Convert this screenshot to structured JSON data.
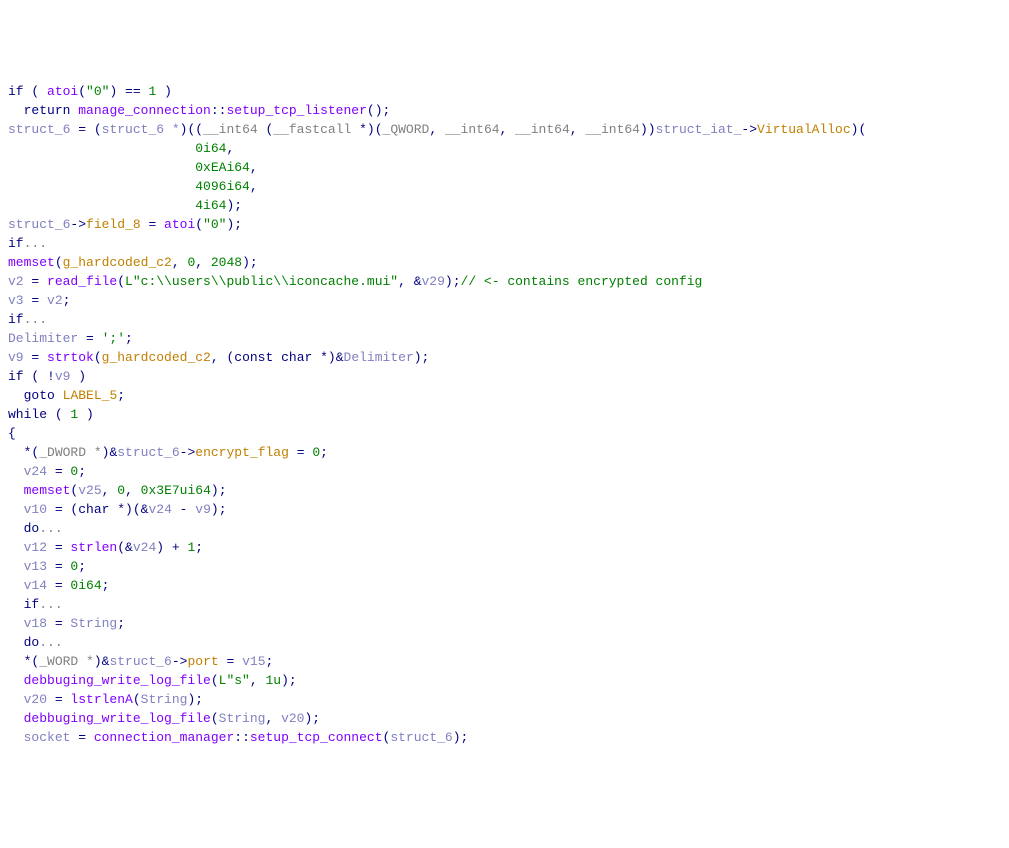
{
  "code": {
    "lines": [
      [
        {
          "t": "if",
          "c": "c-kw"
        },
        {
          "t": " ( ",
          "c": "c-punc"
        },
        {
          "t": "atoi",
          "c": "c-fn"
        },
        {
          "t": "(",
          "c": "c-punc"
        },
        {
          "t": "\"0\"",
          "c": "c-str"
        },
        {
          "t": ") == ",
          "c": "c-punc"
        },
        {
          "t": "1",
          "c": "c-num"
        },
        {
          "t": " )",
          "c": "c-punc"
        }
      ],
      [
        {
          "t": "  ",
          "c": "c-punc"
        },
        {
          "t": "return",
          "c": "c-kw"
        },
        {
          "t": " ",
          "c": "c-punc"
        },
        {
          "t": "manage_connection",
          "c": "c-fn"
        },
        {
          "t": "::",
          "c": "c-punc"
        },
        {
          "t": "setup_tcp_listener",
          "c": "c-fn"
        },
        {
          "t": "();",
          "c": "c-punc"
        }
      ],
      [
        {
          "t": "struct_6",
          "c": "c-var"
        },
        {
          "t": " = (",
          "c": "c-punc"
        },
        {
          "t": "struct_6 *",
          "c": "c-var"
        },
        {
          "t": ")((",
          "c": "c-punc"
        },
        {
          "t": "__int64",
          "c": "c-type"
        },
        {
          "t": " (",
          "c": "c-punc"
        },
        {
          "t": "__fastcall",
          "c": "c-type"
        },
        {
          "t": " *)(",
          "c": "c-punc"
        },
        {
          "t": "_QWORD",
          "c": "c-type"
        },
        {
          "t": ", ",
          "c": "c-punc"
        },
        {
          "t": "__int64",
          "c": "c-type"
        },
        {
          "t": ", ",
          "c": "c-punc"
        },
        {
          "t": "__int64",
          "c": "c-type"
        },
        {
          "t": ", ",
          "c": "c-punc"
        },
        {
          "t": "__int64",
          "c": "c-type"
        },
        {
          "t": "))",
          "c": "c-punc"
        },
        {
          "t": "struct_iat_",
          "c": "c-var"
        },
        {
          "t": "->",
          "c": "c-punc"
        },
        {
          "t": "VirtualAlloc",
          "c": "c-mem"
        },
        {
          "t": ")(",
          "c": "c-punc"
        }
      ],
      [
        {
          "t": "                        ",
          "c": "c-punc"
        },
        {
          "t": "0i64",
          "c": "c-num"
        },
        {
          "t": ",",
          "c": "c-punc"
        }
      ],
      [
        {
          "t": "                        ",
          "c": "c-punc"
        },
        {
          "t": "0xEAi64",
          "c": "c-num"
        },
        {
          "t": ",",
          "c": "c-punc"
        }
      ],
      [
        {
          "t": "                        ",
          "c": "c-punc"
        },
        {
          "t": "4096i64",
          "c": "c-num"
        },
        {
          "t": ",",
          "c": "c-punc"
        }
      ],
      [
        {
          "t": "                        ",
          "c": "c-punc"
        },
        {
          "t": "4i64",
          "c": "c-num"
        },
        {
          "t": ");",
          "c": "c-punc"
        }
      ],
      [
        {
          "t": "struct_6",
          "c": "c-var"
        },
        {
          "t": "->",
          "c": "c-punc"
        },
        {
          "t": "field_8",
          "c": "c-mem"
        },
        {
          "t": " = ",
          "c": "c-punc"
        },
        {
          "t": "atoi",
          "c": "c-fn"
        },
        {
          "t": "(",
          "c": "c-punc"
        },
        {
          "t": "\"0\"",
          "c": "c-str"
        },
        {
          "t": ");",
          "c": "c-punc"
        }
      ],
      [
        {
          "t": "if",
          "c": "c-kw"
        },
        {
          "t": "...",
          "c": "c-type"
        }
      ],
      [
        {
          "t": "memset",
          "c": "c-fn"
        },
        {
          "t": "(",
          "c": "c-punc"
        },
        {
          "t": "g_hardcoded_c2",
          "c": "c-glob"
        },
        {
          "t": ", ",
          "c": "c-punc"
        },
        {
          "t": "0",
          "c": "c-num"
        },
        {
          "t": ", ",
          "c": "c-punc"
        },
        {
          "t": "2048",
          "c": "c-num"
        },
        {
          "t": ");",
          "c": "c-punc"
        }
      ],
      [
        {
          "t": "v2",
          "c": "c-var"
        },
        {
          "t": " = ",
          "c": "c-punc"
        },
        {
          "t": "read_file",
          "c": "c-fn"
        },
        {
          "t": "(",
          "c": "c-punc"
        },
        {
          "t": "L\"c:\\\\users\\\\public\\\\iconcache.mui\"",
          "c": "c-str"
        },
        {
          "t": ", &",
          "c": "c-punc"
        },
        {
          "t": "v29",
          "c": "c-var"
        },
        {
          "t": ");",
          "c": "c-punc"
        },
        {
          "t": "// <- contains encrypted config",
          "c": "c-cmt"
        }
      ],
      [
        {
          "t": "v3",
          "c": "c-var"
        },
        {
          "t": " = ",
          "c": "c-punc"
        },
        {
          "t": "v2",
          "c": "c-var"
        },
        {
          "t": ";",
          "c": "c-punc"
        }
      ],
      [
        {
          "t": "if",
          "c": "c-kw"
        },
        {
          "t": "...",
          "c": "c-type"
        }
      ],
      [
        {
          "t": "Delimiter",
          "c": "c-var"
        },
        {
          "t": " = ",
          "c": "c-punc"
        },
        {
          "t": "';'",
          "c": "c-str"
        },
        {
          "t": ";",
          "c": "c-punc"
        }
      ],
      [
        {
          "t": "v9",
          "c": "c-var"
        },
        {
          "t": " = ",
          "c": "c-punc"
        },
        {
          "t": "strtok",
          "c": "c-fn"
        },
        {
          "t": "(",
          "c": "c-punc"
        },
        {
          "t": "g_hardcoded_c2",
          "c": "c-glob"
        },
        {
          "t": ", (",
          "c": "c-punc"
        },
        {
          "t": "const",
          "c": "c-kw"
        },
        {
          "t": " ",
          "c": "c-punc"
        },
        {
          "t": "char",
          "c": "c-kw"
        },
        {
          "t": " *)&",
          "c": "c-punc"
        },
        {
          "t": "Delimiter",
          "c": "c-var"
        },
        {
          "t": ");",
          "c": "c-punc"
        }
      ],
      [
        {
          "t": "if",
          "c": "c-kw"
        },
        {
          "t": " ( !",
          "c": "c-punc"
        },
        {
          "t": "v9",
          "c": "c-var"
        },
        {
          "t": " )",
          "c": "c-punc"
        }
      ],
      [
        {
          "t": "  ",
          "c": "c-punc"
        },
        {
          "t": "goto",
          "c": "c-kw"
        },
        {
          "t": " ",
          "c": "c-punc"
        },
        {
          "t": "LABEL_5",
          "c": "c-glob"
        },
        {
          "t": ";",
          "c": "c-punc"
        }
      ],
      [
        {
          "t": "while",
          "c": "c-kw"
        },
        {
          "t": " ( ",
          "c": "c-punc"
        },
        {
          "t": "1",
          "c": "c-num"
        },
        {
          "t": " )",
          "c": "c-punc"
        }
      ],
      [
        {
          "t": "{",
          "c": "c-punc"
        }
      ],
      [
        {
          "t": "  *(",
          "c": "c-punc"
        },
        {
          "t": "_DWORD *",
          "c": "c-type"
        },
        {
          "t": ")&",
          "c": "c-punc"
        },
        {
          "t": "struct_6",
          "c": "c-var"
        },
        {
          "t": "->",
          "c": "c-punc"
        },
        {
          "t": "encrypt_flag",
          "c": "c-mem"
        },
        {
          "t": " = ",
          "c": "c-punc"
        },
        {
          "t": "0",
          "c": "c-num"
        },
        {
          "t": ";",
          "c": "c-punc"
        }
      ],
      [
        {
          "t": "  ",
          "c": "c-punc"
        },
        {
          "t": "v24",
          "c": "c-var"
        },
        {
          "t": " = ",
          "c": "c-punc"
        },
        {
          "t": "0",
          "c": "c-num"
        },
        {
          "t": ";",
          "c": "c-punc"
        }
      ],
      [
        {
          "t": "  ",
          "c": "c-punc"
        },
        {
          "t": "memset",
          "c": "c-fn"
        },
        {
          "t": "(",
          "c": "c-punc"
        },
        {
          "t": "v25",
          "c": "c-var"
        },
        {
          "t": ", ",
          "c": "c-punc"
        },
        {
          "t": "0",
          "c": "c-num"
        },
        {
          "t": ", ",
          "c": "c-punc"
        },
        {
          "t": "0x3E7ui64",
          "c": "c-num"
        },
        {
          "t": ");",
          "c": "c-punc"
        }
      ],
      [
        {
          "t": "  ",
          "c": "c-punc"
        },
        {
          "t": "v10",
          "c": "c-var"
        },
        {
          "t": " = (",
          "c": "c-punc"
        },
        {
          "t": "char",
          "c": "c-kw"
        },
        {
          "t": " *)(&",
          "c": "c-punc"
        },
        {
          "t": "v24",
          "c": "c-var"
        },
        {
          "t": " - ",
          "c": "c-punc"
        },
        {
          "t": "v9",
          "c": "c-var"
        },
        {
          "t": ");",
          "c": "c-punc"
        }
      ],
      [
        {
          "t": "  ",
          "c": "c-punc"
        },
        {
          "t": "do",
          "c": "c-kw"
        },
        {
          "t": "...",
          "c": "c-type"
        }
      ],
      [
        {
          "t": "  ",
          "c": "c-punc"
        },
        {
          "t": "v12",
          "c": "c-var"
        },
        {
          "t": " = ",
          "c": "c-punc"
        },
        {
          "t": "strlen",
          "c": "c-fn"
        },
        {
          "t": "(&",
          "c": "c-punc"
        },
        {
          "t": "v24",
          "c": "c-var"
        },
        {
          "t": ") + ",
          "c": "c-punc"
        },
        {
          "t": "1",
          "c": "c-num"
        },
        {
          "t": ";",
          "c": "c-punc"
        }
      ],
      [
        {
          "t": "  ",
          "c": "c-punc"
        },
        {
          "t": "v13",
          "c": "c-var"
        },
        {
          "t": " = ",
          "c": "c-punc"
        },
        {
          "t": "0",
          "c": "c-num"
        },
        {
          "t": ";",
          "c": "c-punc"
        }
      ],
      [
        {
          "t": "  ",
          "c": "c-punc"
        },
        {
          "t": "v14",
          "c": "c-var"
        },
        {
          "t": " = ",
          "c": "c-punc"
        },
        {
          "t": "0i64",
          "c": "c-num"
        },
        {
          "t": ";",
          "c": "c-punc"
        }
      ],
      [
        {
          "t": "  ",
          "c": "c-punc"
        },
        {
          "t": "if",
          "c": "c-kw"
        },
        {
          "t": "...",
          "c": "c-type"
        }
      ],
      [
        {
          "t": "  ",
          "c": "c-punc"
        },
        {
          "t": "v18",
          "c": "c-var"
        },
        {
          "t": " = ",
          "c": "c-punc"
        },
        {
          "t": "String",
          "c": "c-var"
        },
        {
          "t": ";",
          "c": "c-punc"
        }
      ],
      [
        {
          "t": "  ",
          "c": "c-punc"
        },
        {
          "t": "do",
          "c": "c-kw"
        },
        {
          "t": "...",
          "c": "c-type"
        }
      ],
      [
        {
          "t": "  *(",
          "c": "c-punc"
        },
        {
          "t": "_WORD *",
          "c": "c-type"
        },
        {
          "t": ")&",
          "c": "c-punc"
        },
        {
          "t": "struct_6",
          "c": "c-var"
        },
        {
          "t": "->",
          "c": "c-punc"
        },
        {
          "t": "port",
          "c": "c-mem"
        },
        {
          "t": " = ",
          "c": "c-punc"
        },
        {
          "t": "v15",
          "c": "c-var"
        },
        {
          "t": ";",
          "c": "c-punc"
        }
      ],
      [
        {
          "t": "  ",
          "c": "c-punc"
        },
        {
          "t": "debbuging_write_log_file",
          "c": "c-fn"
        },
        {
          "t": "(",
          "c": "c-punc"
        },
        {
          "t": "L\"s\"",
          "c": "c-str"
        },
        {
          "t": ", ",
          "c": "c-punc"
        },
        {
          "t": "1u",
          "c": "c-num"
        },
        {
          "t": ");",
          "c": "c-punc"
        }
      ],
      [
        {
          "t": "  ",
          "c": "c-punc"
        },
        {
          "t": "v20",
          "c": "c-var"
        },
        {
          "t": " = ",
          "c": "c-punc"
        },
        {
          "t": "lstrlenA",
          "c": "c-fn"
        },
        {
          "t": "(",
          "c": "c-punc"
        },
        {
          "t": "String",
          "c": "c-var"
        },
        {
          "t": ");",
          "c": "c-punc"
        }
      ],
      [
        {
          "t": "  ",
          "c": "c-punc"
        },
        {
          "t": "debbuging_write_log_file",
          "c": "c-fn"
        },
        {
          "t": "(",
          "c": "c-punc"
        },
        {
          "t": "String",
          "c": "c-var"
        },
        {
          "t": ", ",
          "c": "c-punc"
        },
        {
          "t": "v20",
          "c": "c-var"
        },
        {
          "t": ");",
          "c": "c-punc"
        }
      ],
      [
        {
          "t": "  ",
          "c": "c-punc"
        },
        {
          "t": "socket",
          "c": "c-var"
        },
        {
          "t": " = ",
          "c": "c-punc"
        },
        {
          "t": "connection_manager",
          "c": "c-fn"
        },
        {
          "t": "::",
          "c": "c-punc"
        },
        {
          "t": "setup_tcp_connect",
          "c": "c-fn"
        },
        {
          "t": "(",
          "c": "c-punc"
        },
        {
          "t": "struct_6",
          "c": "c-var"
        },
        {
          "t": ");",
          "c": "c-punc"
        }
      ]
    ]
  }
}
